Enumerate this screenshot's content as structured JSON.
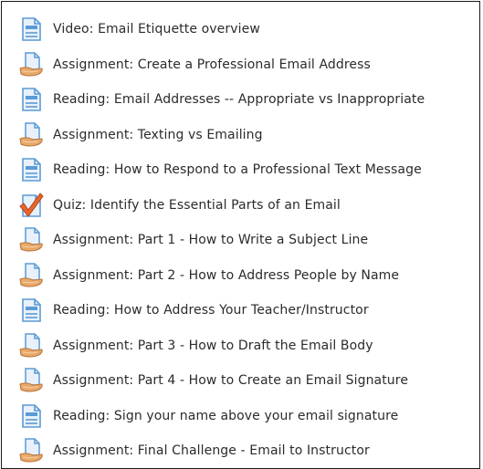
{
  "activities": [
    {
      "type": "page",
      "icon": "page-icon",
      "label": "Video: Email Etiquette overview"
    },
    {
      "type": "assignment",
      "icon": "assignment-icon",
      "label": "Assignment: Create a Professional Email Address"
    },
    {
      "type": "page",
      "icon": "page-icon",
      "label": "Reading: Email Addresses -- Appropriate vs Inappropriate"
    },
    {
      "type": "assignment",
      "icon": "assignment-icon",
      "label": "Assignment: Texting vs Emailing"
    },
    {
      "type": "page",
      "icon": "page-icon",
      "label": "Reading: How to Respond to a Professional Text Message"
    },
    {
      "type": "quiz",
      "icon": "quiz-icon",
      "label": "Quiz: Identify the Essential Parts of an Email"
    },
    {
      "type": "assignment",
      "icon": "assignment-icon",
      "label": "Assignment: Part 1 - How to Write a Subject Line"
    },
    {
      "type": "assignment",
      "icon": "assignment-icon",
      "label": "Assignment: Part 2 - How to Address People by Name"
    },
    {
      "type": "page",
      "icon": "page-icon",
      "label": "Reading: How to Address Your Teacher/Instructor"
    },
    {
      "type": "assignment",
      "icon": "assignment-icon",
      "label": "Assignment: Part 3 - How to Draft the Email Body"
    },
    {
      "type": "assignment",
      "icon": "assignment-icon",
      "label": "Assignment: Part 4 - How to Create an Email Signature"
    },
    {
      "type": "page",
      "icon": "page-icon",
      "label": "Reading: Sign your name above your email signature"
    },
    {
      "type": "assignment",
      "icon": "assignment-icon",
      "label": "Assignment: Final Challenge - Email to Instructor"
    }
  ],
  "colors": {
    "text": "#2b2b2b",
    "page_blue": "#5b9bd5",
    "page_fill": "#e8f1fb",
    "hand": "#e8a86a",
    "quiz_check": "#e8672a"
  }
}
